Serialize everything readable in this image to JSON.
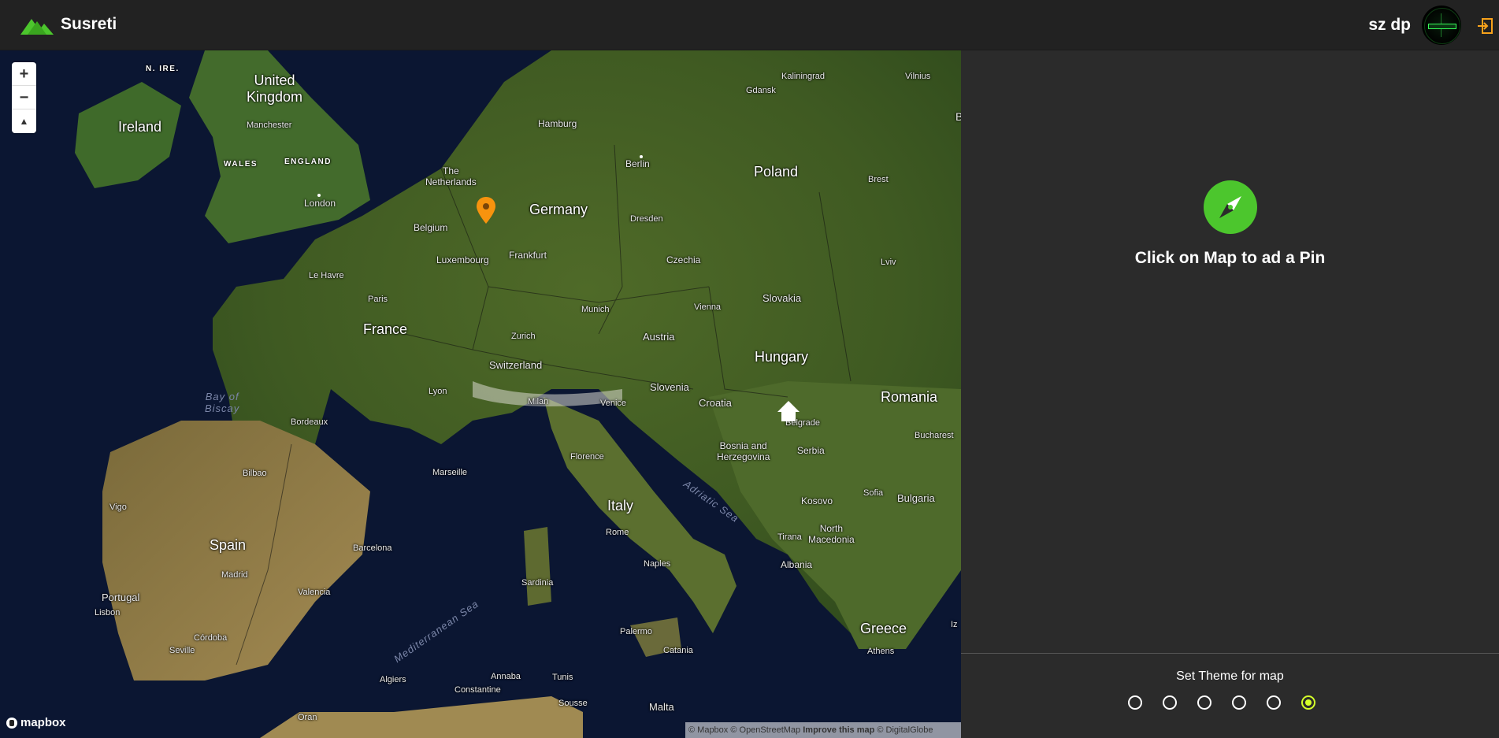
{
  "header": {
    "app_title": "Susreti",
    "username": "sz dp",
    "avatar_icon": "avatar-image",
    "logout_icon": "logout-icon",
    "accent_color": "#f7a21b",
    "logo_color": "#4cc62d"
  },
  "map": {
    "zoom_in": "+",
    "zoom_out": "−",
    "compass": "▲",
    "logo": "mapbox",
    "attribution": {
      "text1": "© Mapbox © OpenStreetMap",
      "improve": "Improve this map",
      "text2": "© DigitalGlobe"
    },
    "labels": {
      "united_kingdom": "United\nKingdom",
      "ireland": "Ireland",
      "n_ire": "N. IRE.",
      "manchester": "Manchester",
      "wales": "WALES",
      "england": "ENGLAND",
      "london": "London",
      "netherlands": "The\nNetherlands",
      "belgium": "Belgium",
      "luxembourg": "Luxembourg",
      "hamburg": "Hamburg",
      "germany": "Germany",
      "berlin": "Berlin",
      "dresden": "Dresden",
      "frankfurt": "Frankfurt",
      "kaliningrad": "Kaliningrad",
      "gdansk": "Gdansk",
      "vilnius": "Vilnius",
      "poland": "Poland",
      "brest": "Brest",
      "czechia": "Czechia",
      "lviv": "Lviv",
      "le_havre": "Le Havre",
      "paris": "Paris",
      "france": "France",
      "munich": "Munich",
      "vienna": "Vienna",
      "slovakia": "Slovakia",
      "austria": "Austria",
      "zurich": "Zurich",
      "switzerland": "Switzerland",
      "hungary": "Hungary",
      "bay_of_biscay": "Bay of\nBiscay",
      "lyon": "Lyon",
      "slovenia": "Slovenia",
      "milan": "Milan",
      "venice": "Venice",
      "croatia": "Croatia",
      "romania": "Romania",
      "bordeaux": "Bordeaux",
      "belgrade": "Belgrade",
      "bucharest": "Bucharest",
      "bosnia": "Bosnia and\nHerzegovina",
      "serbia": "Serbia",
      "florence": "Florence",
      "marseille": "Marseille",
      "bilbao": "Bilbao",
      "vigo": "Vigo",
      "adriatic_sea": "Adriatic Sea",
      "kosovo": "Kosovo",
      "sofia": "Sofia",
      "bulgaria": "Bulgaria",
      "italy": "Italy",
      "rome": "Rome",
      "north_macedonia": "North\nMacedonia",
      "tirana": "Tirana",
      "spain": "Spain",
      "barcelona": "Barcelona",
      "albania": "Albania",
      "naples": "Naples",
      "madrid": "Madrid",
      "portugal": "Portugal",
      "lisbon": "Lisbon",
      "valencia": "Valencia",
      "sardinia": "Sardinia",
      "mediterranean_sea": "Mediterranean Sea",
      "greece": "Greece",
      "palermo": "Palermo",
      "cordoba": "Córdoba",
      "seville": "Seville",
      "catania": "Catania",
      "athens": "Athens",
      "algiers": "Algiers",
      "annaba": "Annaba",
      "constantine": "Constantine",
      "tunis": "Tunis",
      "sousse": "Sousse",
      "malta": "Malta",
      "oran": "Oran",
      "b_edge": "B",
      "iz_edge": "Iz"
    },
    "pin_color": "#f7930e"
  },
  "panel": {
    "message": "Click on Map to ad a Pin",
    "compass_icon": "compass-icon",
    "compass_color": "#4cc62d",
    "theme_title": "Set Theme for map",
    "theme_selected_color": "#d4ff2a",
    "themes": [
      {
        "selected": false
      },
      {
        "selected": false
      },
      {
        "selected": false
      },
      {
        "selected": false
      },
      {
        "selected": false
      },
      {
        "selected": true
      }
    ]
  }
}
